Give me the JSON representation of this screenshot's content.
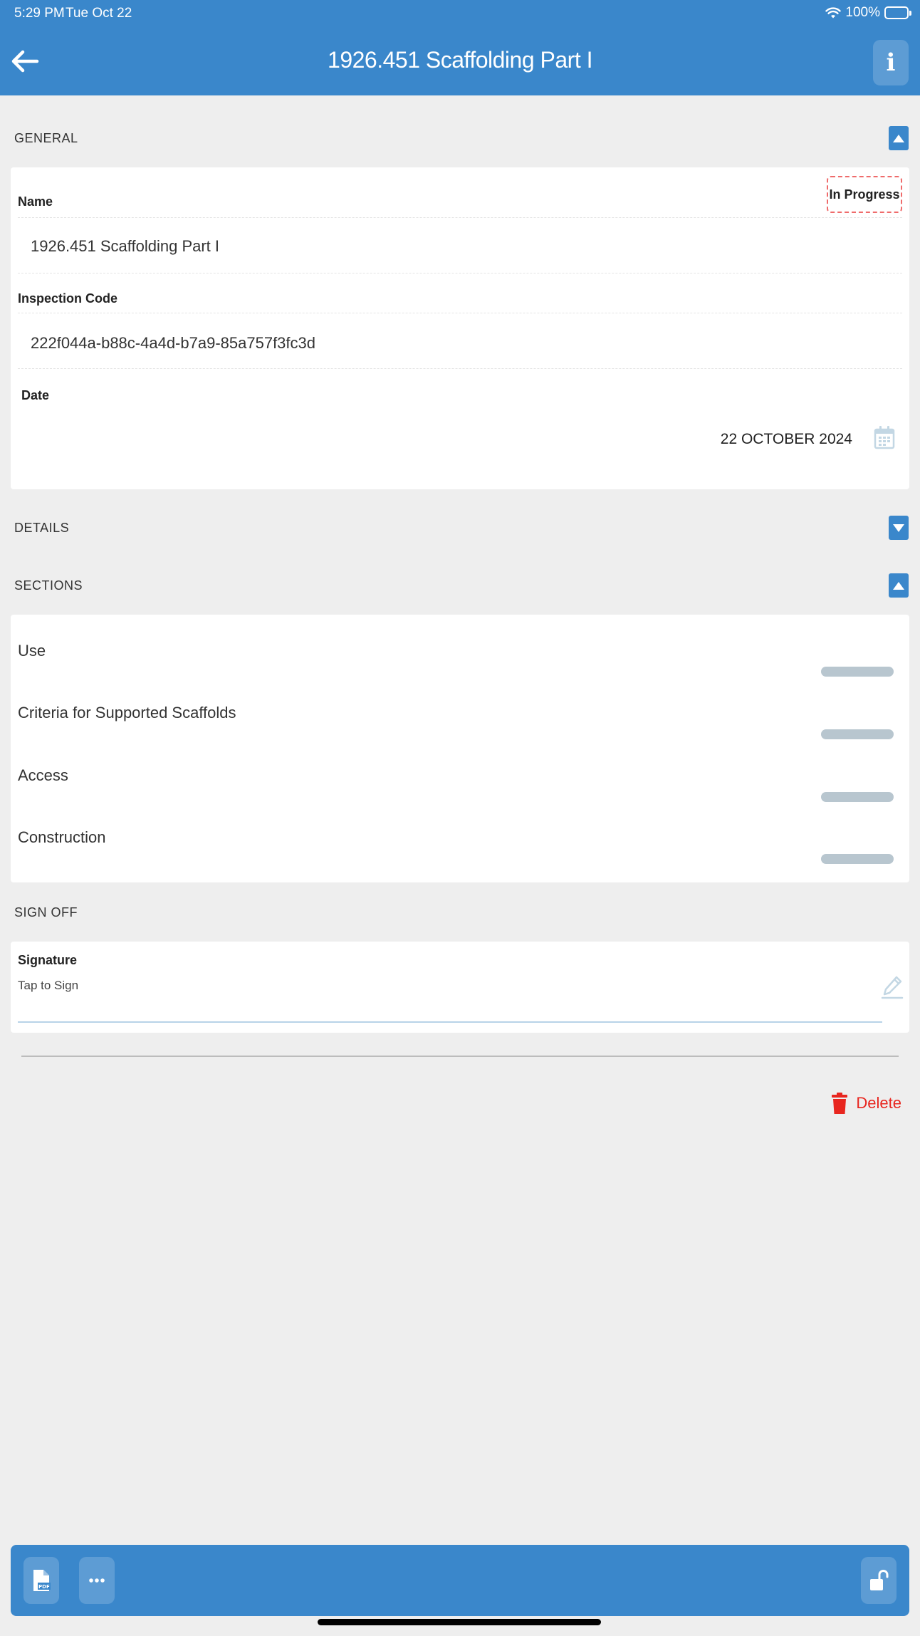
{
  "status_bar": {
    "time": "5:29 PM",
    "date": "Tue Oct 22",
    "battery": "100%"
  },
  "header": {
    "title": "1926.451 Scaffolding Part I"
  },
  "general": {
    "label": "GENERAL",
    "status": "In Progress",
    "name_label": "Name",
    "name_value": "1926.451 Scaffolding Part I",
    "code_label": "Inspection Code",
    "code_value": "222f044a-b88c-4a4d-b7a9-85a757f3fc3d",
    "date_label": "Date",
    "date_value": "22 OCTOBER 2024"
  },
  "details": {
    "label": "DETAILS"
  },
  "sections": {
    "label": "SECTIONS",
    "items": [
      {
        "label": "Use"
      },
      {
        "label": "Criteria for Supported Scaffolds"
      },
      {
        "label": "Access"
      },
      {
        "label": "Construction"
      }
    ]
  },
  "signoff": {
    "label": "SIGN OFF",
    "signature_label": "Signature",
    "signature_hint": "Tap to Sign"
  },
  "actions": {
    "delete_label": "Delete"
  },
  "colors": {
    "primary": "#3a87cb",
    "danger": "#e8261f",
    "badge_border": "#ef6b6b",
    "progress": "#b8c6cf"
  }
}
